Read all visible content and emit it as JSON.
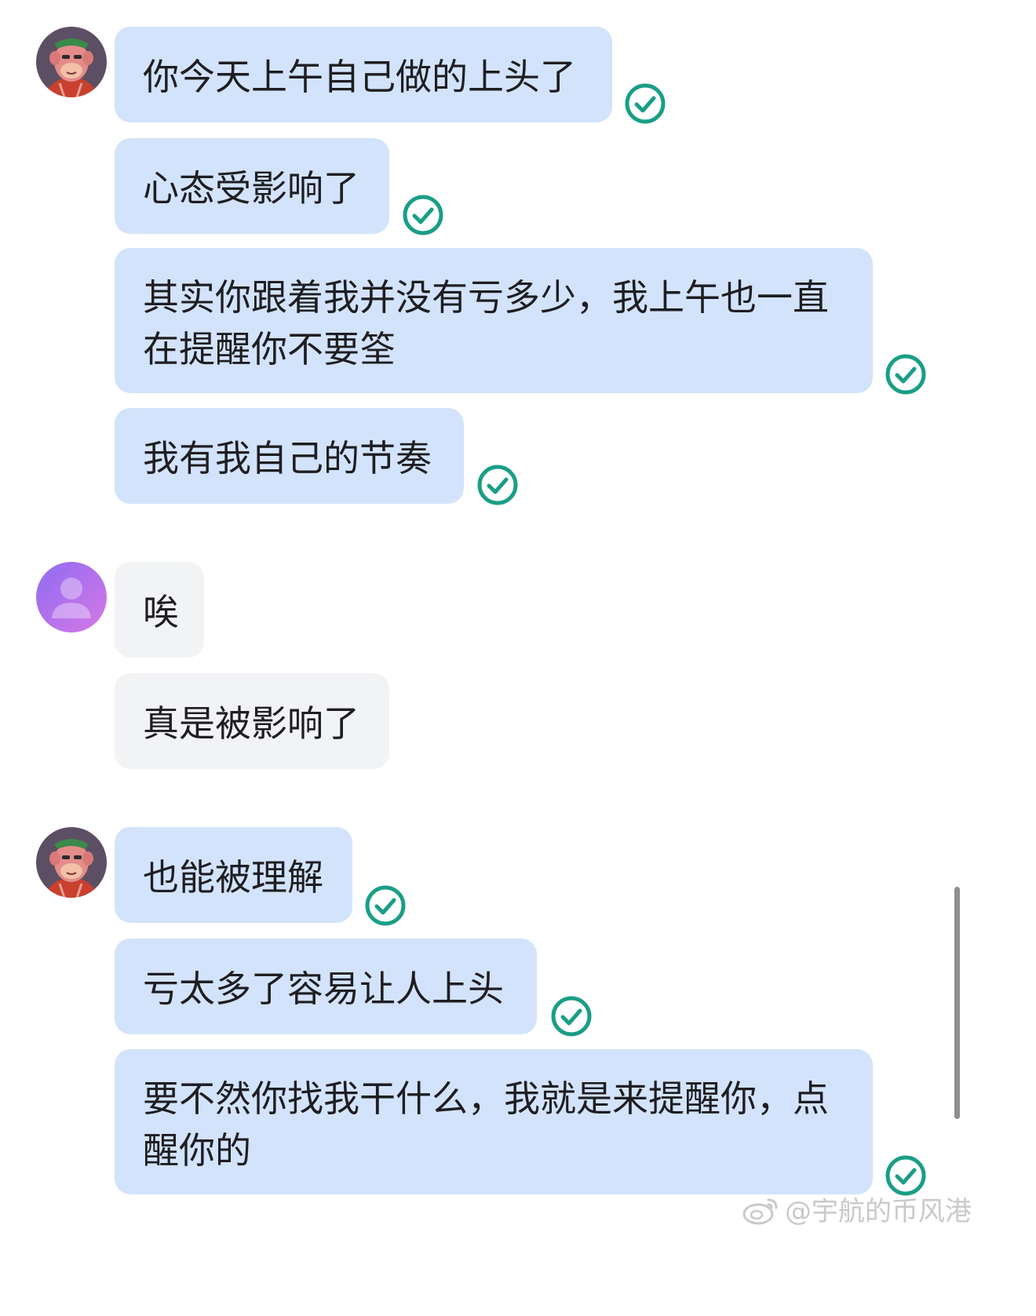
{
  "colors": {
    "my_bubble": "#d3e3fb",
    "their_bubble": "#f2f3f5",
    "check": "#1a9e86"
  },
  "groups": [
    {
      "sender": "me",
      "avatar_icon": "ape-avatar-icon",
      "messages": [
        {
          "text": "你今天上午自己做的上头了",
          "status_icon": "read-check-icon"
        },
        {
          "text": "心态受影响了",
          "status_icon": "read-check-icon"
        },
        {
          "text": "其实你跟着我并没有亏多少，我上午也一直在提醒你不要筌",
          "status_icon": "read-check-icon"
        },
        {
          "text": "我有我自己的节奏",
          "status_icon": "read-check-icon"
        }
      ]
    },
    {
      "sender": "other",
      "avatar_icon": "default-user-avatar-icon",
      "messages": [
        {
          "text": "唉"
        },
        {
          "text": "真是被影响了"
        }
      ]
    },
    {
      "sender": "me",
      "avatar_icon": "ape-avatar-icon",
      "messages": [
        {
          "text": "也能被理解",
          "status_icon": "read-check-icon"
        },
        {
          "text": "亏太多了容易让人上头",
          "status_icon": "read-check-icon"
        },
        {
          "text": "要不然你找我干什么，我就是来提醒你，点醒你的",
          "status_icon": "read-check-icon"
        }
      ]
    }
  ],
  "watermark": {
    "icon": "weibo-logo-icon",
    "text": "@宇航的币风港"
  }
}
